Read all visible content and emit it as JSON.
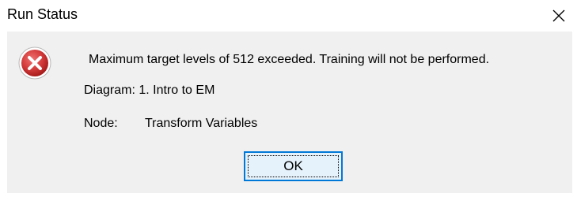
{
  "window": {
    "title": "Run Status",
    "close_icon": "close-icon"
  },
  "message": {
    "icon": "error-icon",
    "text": "Maximum target levels of 512 exceeded. Training will not be performed.",
    "diagram": "Diagram: 1. Intro to EM",
    "node_label": "Node:",
    "node_value": "Transform Variables"
  },
  "buttons": {
    "ok_label": "OK"
  },
  "colors": {
    "error_red": "#c4282b",
    "focus_blue": "#0078d7",
    "panel_bg": "#f0f0f0"
  }
}
